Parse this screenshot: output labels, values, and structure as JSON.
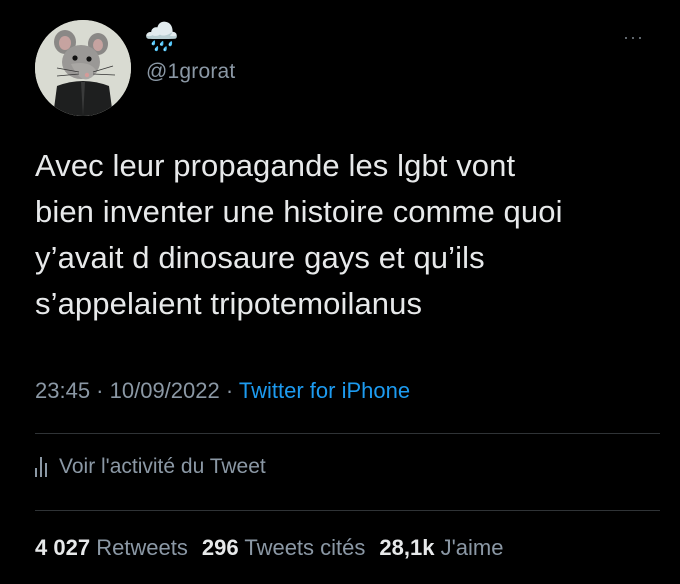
{
  "user": {
    "display_name": "🌧️",
    "handle": "@1grorat",
    "avatar_icon": "rat-avatar-icon"
  },
  "menu": {
    "more_label": "···"
  },
  "tweet": {
    "text": "Avec leur propagande les lgbt vont\nbien inventer une histoire comme quoi\ny’avait d dinosaure gays et qu’ils\ns’appelaient tripotemoilanus",
    "time": "23:45",
    "separator": " · ",
    "date": "10/09/2022",
    "source": "Twitter for iPhone"
  },
  "activity": {
    "icon": "analytics-bars-icon",
    "label": "Voir l'activité du Tweet"
  },
  "stats": {
    "retweets_count": "4 027",
    "retweets_label": "Retweets",
    "quotes_count": "296",
    "quotes_label": "Tweets cités",
    "likes_count": "28,1k",
    "likes_label": "J'aime"
  },
  "colors": {
    "background": "#000000",
    "text": "#e7e9ea",
    "secondary": "#8b98a5",
    "link": "#1d9bf0",
    "divider": "#2f3336"
  }
}
